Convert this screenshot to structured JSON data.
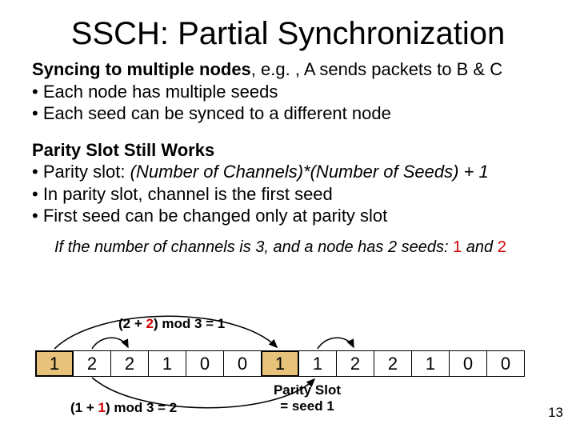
{
  "title": "SSCH: Partial Synchronization",
  "block1": {
    "lead": "Syncing to multiple nodes",
    "tail": ", e.g. , A sends packets to B & C",
    "b1": "• Each node has multiple seeds",
    "b2": "• Each seed can be synced to a different node"
  },
  "block2": {
    "lead": "Parity Slot Still Works",
    "p1_a": "• Parity slot: ",
    "p1_i": "(Number of Channels)*(Number of Seeds) + 1",
    "p2": "• In parity slot, channel is the first seed",
    "p3": "• First seed can be changed only at parity slot"
  },
  "example": {
    "pre": "If the number of channels is 3, and a node has 2 seeds: ",
    "s1": "1",
    "mid": " and ",
    "s2": "2"
  },
  "formula_top": {
    "a": "(2 + ",
    "r": "2",
    "b": ") mod 3 = 1"
  },
  "formula_bot": {
    "a": "(1 + ",
    "r": "1",
    "b": ") mod 3 = 2"
  },
  "seq": [
    "1",
    "2",
    "2",
    "1",
    "0",
    "0",
    "1",
    "1",
    "2",
    "2",
    "1",
    "0",
    "0"
  ],
  "parity_index": 6,
  "parity_label_l1": "Parity Slot",
  "parity_label_l2": "= seed 1",
  "page": "13"
}
